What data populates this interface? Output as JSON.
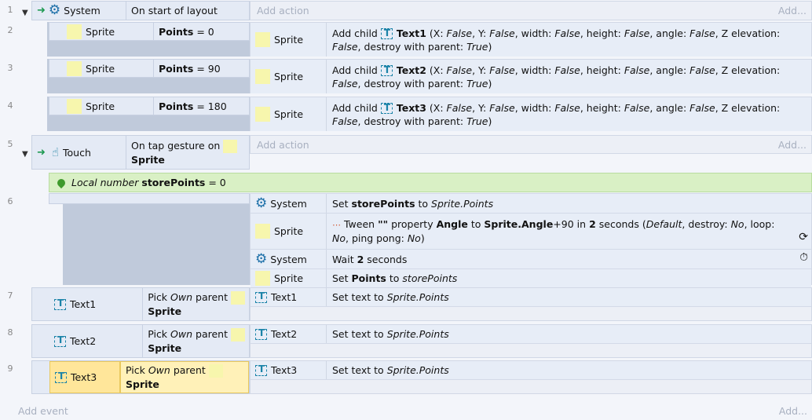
{
  "line_numbers": [
    "1",
    "2",
    "3",
    "4",
    "5",
    "6",
    "7",
    "8",
    "9"
  ],
  "add_action": "Add action",
  "add_dots": "Add...",
  "add_event": "Add event",
  "events": {
    "e1": {
      "object": "System",
      "condition": "On start of layout"
    },
    "e2": {
      "object": "Sprite",
      "cond_var": "Points",
      "cond_val": "= 0",
      "act_object": "Sprite",
      "act_pre": "Add child",
      "act_target": "Text1"
    },
    "e3": {
      "object": "Sprite",
      "cond_var": "Points",
      "cond_val": "= 90",
      "act_object": "Sprite",
      "act_pre": "Add child",
      "act_target": "Text2"
    },
    "e4": {
      "object": "Sprite",
      "cond_var": "Points",
      "cond_val": "= 180",
      "act_object": "Sprite",
      "act_pre": "Add child",
      "act_target": "Text3"
    },
    "e5": {
      "object": "Touch",
      "condition": "On tap gesture on",
      "cond_obj": "Sprite"
    },
    "e6": {
      "local_prefix": "Local number",
      "local_name": "storePoints",
      "local_val": "= 0",
      "a1_obj": "System",
      "a1_pre": "Set",
      "a1_var": "storePoints",
      "a1_mid": "to",
      "a1_val": "Sprite.Points",
      "a2_obj": "Sprite",
      "a2_pre": "Tween",
      "a2_quote": "\"\"",
      "a2_prop": "property",
      "a2_propname": "Angle",
      "a2_to": "to",
      "a2_expr": "Sprite.Angle",
      "a2_plus": "+90",
      "a2_in": "in",
      "a2_num": "2",
      "a2_sec": "seconds (",
      "a2_default": "Default",
      "a2_destroy": ", destroy: ",
      "a2_no1": "No",
      "a2_loop": ", loop: ",
      "a2_no2": "No",
      "a2_pp": ", ping pong: ",
      "a2_no3": "No",
      "a2_close": ")",
      "a3_obj": "System",
      "a3_pre": "Wait",
      "a3_num": "2",
      "a3_post": "seconds",
      "a4_obj": "Sprite",
      "a4_pre": "Set",
      "a4_var": "Points",
      "a4_mid": "to",
      "a4_val": "storePoints"
    },
    "e7": {
      "object": "Text1",
      "pick": "Pick",
      "own": "Own",
      "parent": "parent",
      "cond_obj": "Sprite",
      "act_object": "Text1",
      "act_pre": "Set text to",
      "act_val": "Sprite.Points"
    },
    "e8": {
      "object": "Text2",
      "pick": "Pick",
      "own": "Own",
      "parent": "parent",
      "cond_obj": "Sprite",
      "act_object": "Text2",
      "act_pre": "Set text to",
      "act_val": "Sprite.Points"
    },
    "e9": {
      "object": "Text3",
      "pick": "Pick",
      "own": "Own",
      "parent": "parent",
      "cond_obj": "Sprite",
      "act_object": "Text3",
      "act_pre": "Set text to",
      "act_val": "Sprite.Points"
    }
  },
  "addchild_params": {
    "x": "(X: ",
    "f1": "False",
    "y": ", Y: ",
    "f2": "False",
    "w": ", width: ",
    "f3": "False",
    "h": ", height: ",
    "f4": "False",
    "a": ", angle: ",
    "f5": "False",
    "z": ", Z elevation: ",
    "f6": "False",
    "d": ", destroy with parent: ",
    "t": "True",
    "close": ")"
  }
}
